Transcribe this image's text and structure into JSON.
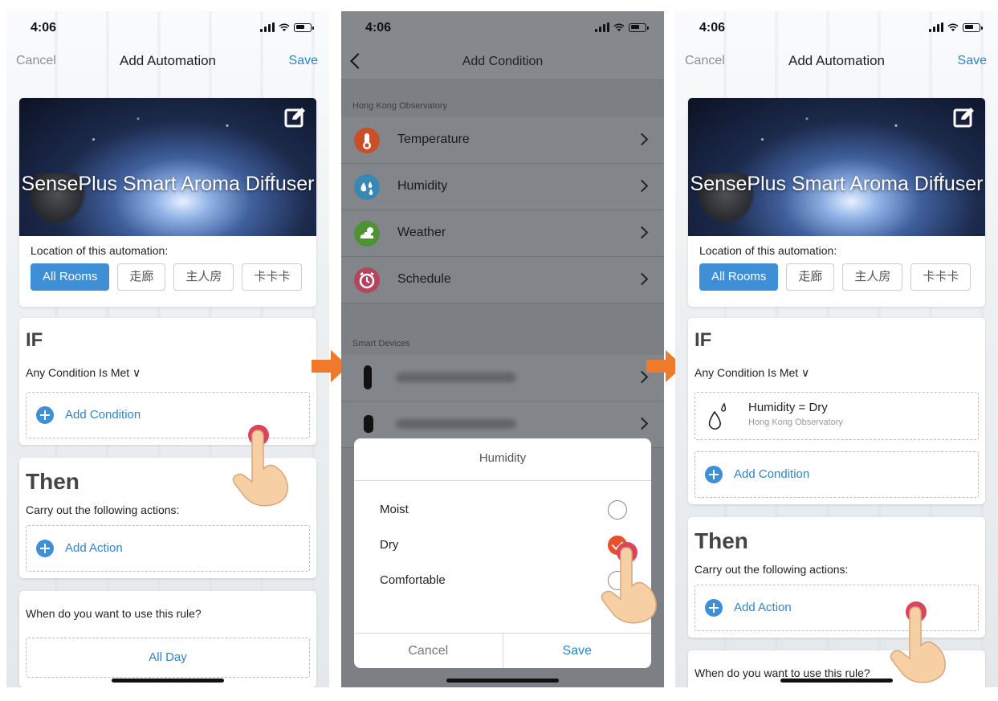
{
  "status": {
    "time": "4:06"
  },
  "screen1": {
    "nav": {
      "cancel": "Cancel",
      "title": "Add Automation",
      "save": "Save"
    },
    "hero_title": "SensePlus Smart Aroma Diffuser",
    "location_label": "Location of this automation:",
    "rooms": [
      "All Rooms",
      "走廊",
      "主人房",
      "卡卡卡"
    ],
    "if": {
      "heading": "IF",
      "condition_mode": "Any Condition Is Met ∨",
      "add_condition": "Add Condition"
    },
    "then": {
      "heading": "Then",
      "subheading": "Carry out the following actions:",
      "add_action": "Add Action"
    },
    "when": {
      "question": "When do you want to use this rule?",
      "value": "All Day"
    }
  },
  "screen2": {
    "nav": {
      "title": "Add Condition"
    },
    "section1": "Hong Kong Observatory",
    "conditions": [
      {
        "label": "Temperature",
        "icon": "thermometer-icon",
        "color": "#e05a2b"
      },
      {
        "label": "Humidity",
        "icon": "water-drops-icon",
        "color": "#3d9ac9"
      },
      {
        "label": "Weather",
        "icon": "cloud-sun-icon",
        "color": "#5aa93c"
      },
      {
        "label": "Schedule",
        "icon": "alarm-clock-icon",
        "color": "#d04a6b"
      }
    ],
    "section2": "Smart Devices",
    "dialog": {
      "title": "Humidity",
      "options": [
        {
          "label": "Moist",
          "selected": false
        },
        {
          "label": "Dry",
          "selected": true
        },
        {
          "label": "Comfortable",
          "selected": false
        }
      ],
      "cancel": "Cancel",
      "save": "Save"
    }
  },
  "screen3": {
    "nav": {
      "cancel": "Cancel",
      "title": "Add Automation",
      "save": "Save"
    },
    "hero_title": "SensePlus Smart Aroma Diffuser",
    "location_label": "Location of this automation:",
    "rooms": [
      "All Rooms",
      "走廊",
      "主人房",
      "卡卡卡"
    ],
    "if": {
      "heading": "IF",
      "condition_mode": "Any Condition Is Met ∨",
      "add_condition": "Add Condition"
    },
    "condition_item": {
      "title": "Humidity = Dry",
      "source": "Hong Kong Observatory"
    },
    "then": {
      "heading": "Then",
      "subheading": "Carry out the following actions:",
      "add_action": "Add Action"
    },
    "when": {
      "question": "When do you want to use this rule?"
    }
  },
  "colors": {
    "accent": "#2f84c9",
    "arrow": "#f07a2c",
    "chip_active": "#3f8fd6"
  }
}
